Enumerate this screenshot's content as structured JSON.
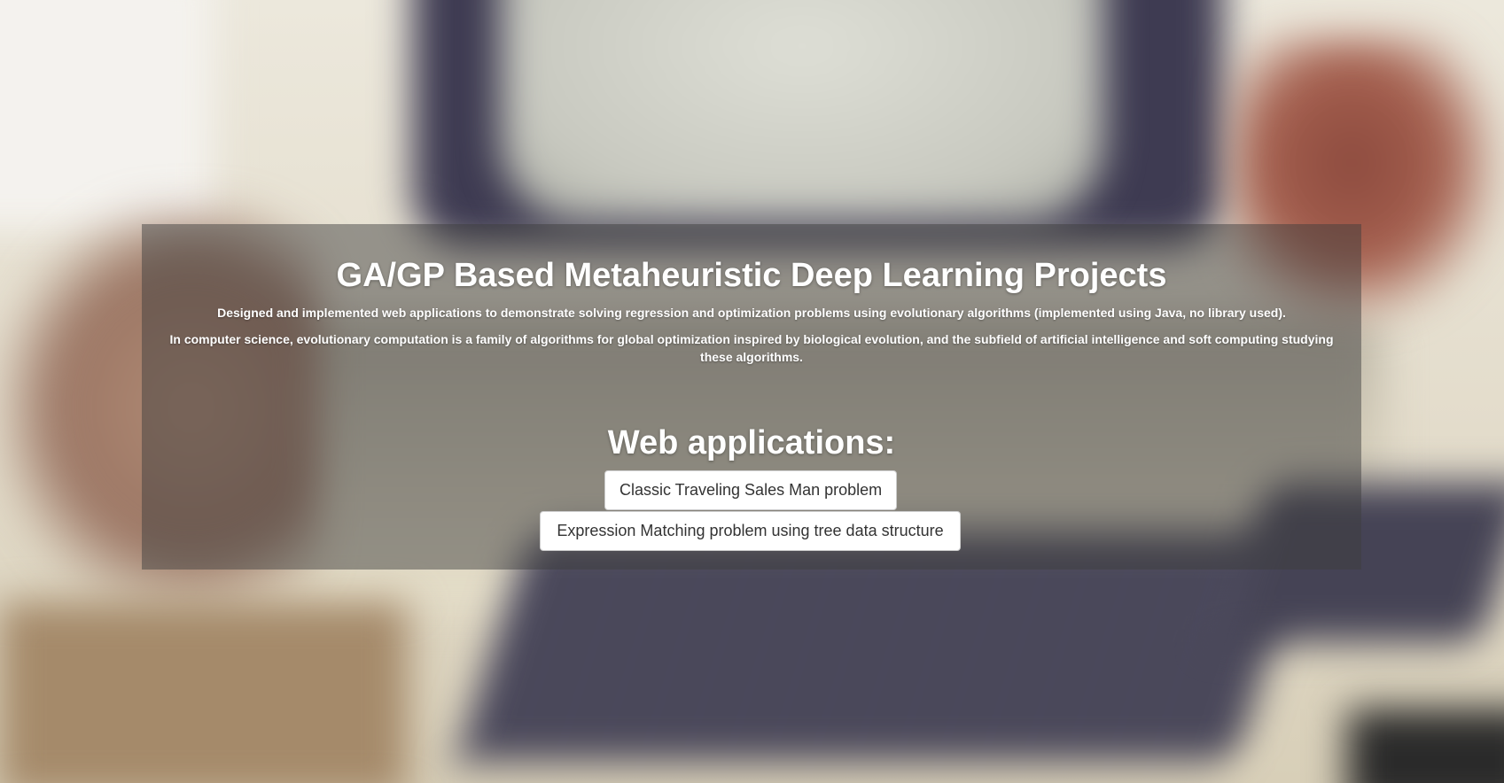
{
  "hero": {
    "title": "GA/GP Based Metaheuristic Deep Learning Projects",
    "lead_1": "Designed and implemented web applications to demonstrate solving regression and optimization problems using evolutionary algorithms (implemented using Java, no library used).",
    "lead_2": "In computer science, evolutionary computation is a family of algorithms for global optimization inspired by biological evolution, and the subfield of artificial intelligence and soft computing studying these algorithms."
  },
  "apps": {
    "heading": "Web applications:",
    "buttons": [
      {
        "label": "Classic Traveling Sales Man problem"
      },
      {
        "label": "Expression Matching problem using tree data structure"
      }
    ]
  },
  "colors": {
    "panel_overlay": "#3c3c3c",
    "text": "#ffffff",
    "button_bg": "#ffffff",
    "button_text": "#333333"
  }
}
